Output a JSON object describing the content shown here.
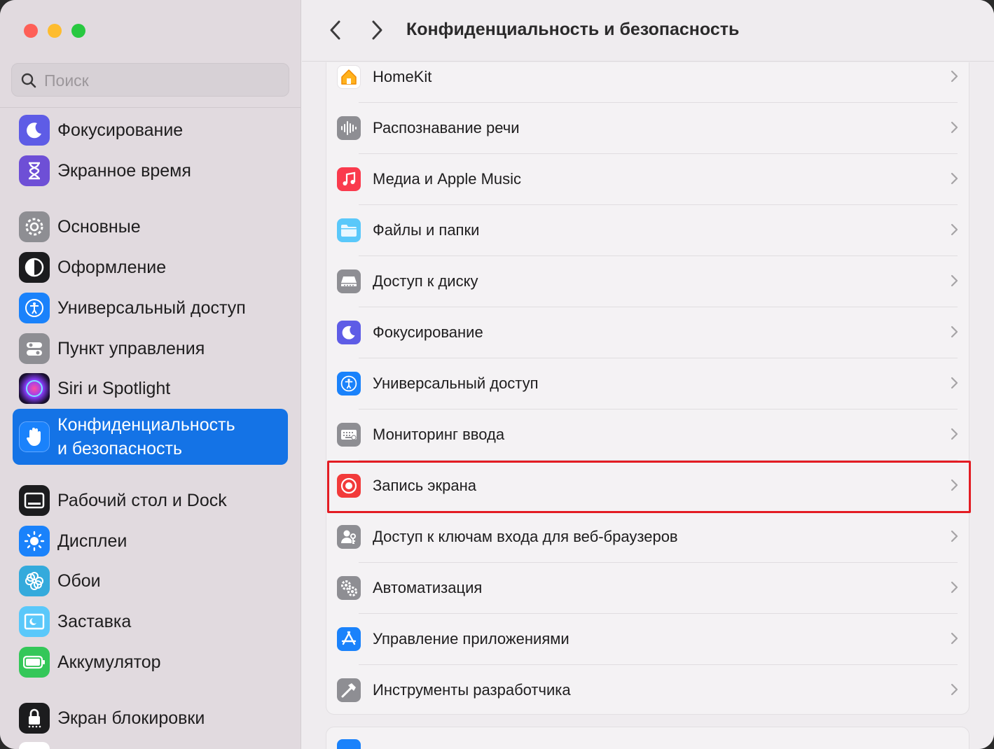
{
  "window": {
    "title": "Конфиденциальность и безопасность"
  },
  "search": {
    "placeholder": "Поиск"
  },
  "sidebar": {
    "items": [
      {
        "label": "Фокусирование",
        "icon": "moon-icon",
        "color": "#5e5ce6"
      },
      {
        "label": "Экранное время",
        "icon": "hourglass-icon",
        "color": "#6e4fd6"
      },
      {
        "label": "Основные",
        "icon": "gear-icon",
        "color": "#8e8e93"
      },
      {
        "label": "Оформление",
        "icon": "appearance-icon",
        "color": "#1c1c1e"
      },
      {
        "label": "Универсальный доступ",
        "icon": "accessibility-icon",
        "color": "#1a82fb"
      },
      {
        "label": "Пункт управления",
        "icon": "control-center-icon",
        "color": "#8e8e93"
      },
      {
        "label": "Siri и Spotlight",
        "icon": "siri-icon",
        "color": "#2d1b3d"
      },
      {
        "label": "Конфиденциальность\nи безопасность",
        "icon": "hand-icon",
        "color": "#1a82fb",
        "selected": true
      },
      {
        "label": "Рабочий стол и Dock",
        "icon": "dock-icon",
        "color": "#1c1c1e"
      },
      {
        "label": "Дисплеи",
        "icon": "brightness-icon",
        "color": "#1a82fb"
      },
      {
        "label": "Обои",
        "icon": "flower-icon",
        "color": "#34aadc"
      },
      {
        "label": "Заставка",
        "icon": "screensaver-icon",
        "color": "#5ac8fa"
      },
      {
        "label": "Аккумулятор",
        "icon": "battery-icon",
        "color": "#34c759"
      },
      {
        "label": "Экран блокировки",
        "icon": "lock-icon",
        "color": "#1c1c1e"
      }
    ]
  },
  "privacy_list": {
    "rows": [
      {
        "label": "HomeKit",
        "icon": "home-icon",
        "color": "#ffffff"
      },
      {
        "label": "Распознавание речи",
        "icon": "waveform-icon",
        "color": "#8e8e93"
      },
      {
        "label": "Медиа и Apple Music",
        "icon": "music-note-icon",
        "color": "#fa3a4d"
      },
      {
        "label": "Файлы и папки",
        "icon": "folder-icon",
        "color": "#5ac8fa"
      },
      {
        "label": "Доступ к диску",
        "icon": "disk-icon",
        "color": "#8e8e93"
      },
      {
        "label": "Фокусирование",
        "icon": "moon-icon",
        "color": "#5e5ce6"
      },
      {
        "label": "Универсальный доступ",
        "icon": "accessibility-icon",
        "color": "#1a82fb"
      },
      {
        "label": "Мониторинг ввода",
        "icon": "keyboard-icon",
        "color": "#8e8e93"
      },
      {
        "label": "Запись экрана",
        "icon": "record-icon",
        "color": "#f23a3a",
        "highlighted": true
      },
      {
        "label": "Доступ к ключам входа для веб-браузеров",
        "icon": "person-key-icon",
        "color": "#8e8e93"
      },
      {
        "label": "Автоматизация",
        "icon": "gears-icon",
        "color": "#8e8e93"
      },
      {
        "label": "Управление приложениями",
        "icon": "app-store-icon",
        "color": "#1a82fb"
      },
      {
        "label": "Инструменты разработчика",
        "icon": "hammer-icon",
        "color": "#8e8e93"
      }
    ]
  },
  "colors": {
    "accent": "#1473e6",
    "highlight_border": "#e31c23"
  }
}
